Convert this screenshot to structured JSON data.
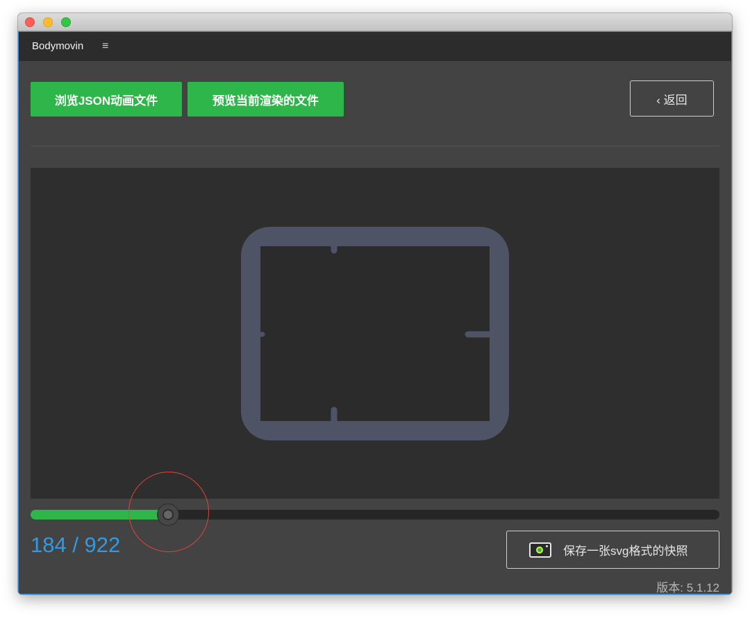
{
  "app": {
    "title": "Bodymovin",
    "menu_icon": "hamburger-icon"
  },
  "toolbar": {
    "browse_json_label": "浏览JSON动画文件",
    "preview_rendered_label": "预览当前渲染的文件",
    "back_label": "‹ 返回"
  },
  "player": {
    "current_frame": 184,
    "total_frames": 922,
    "frame_display": "184 / 922",
    "progress_fraction": 0.2
  },
  "snapshot": {
    "label": "保存一张svg格式的快照",
    "icon": "camera-icon"
  },
  "footer": {
    "version": "版本: 5.1.12"
  },
  "colors": {
    "accent_green": "#2fb64a",
    "frame_counter_blue": "#2f9be6",
    "shape_stroke": "#4e5366",
    "highlight_red": "#e0453b"
  }
}
